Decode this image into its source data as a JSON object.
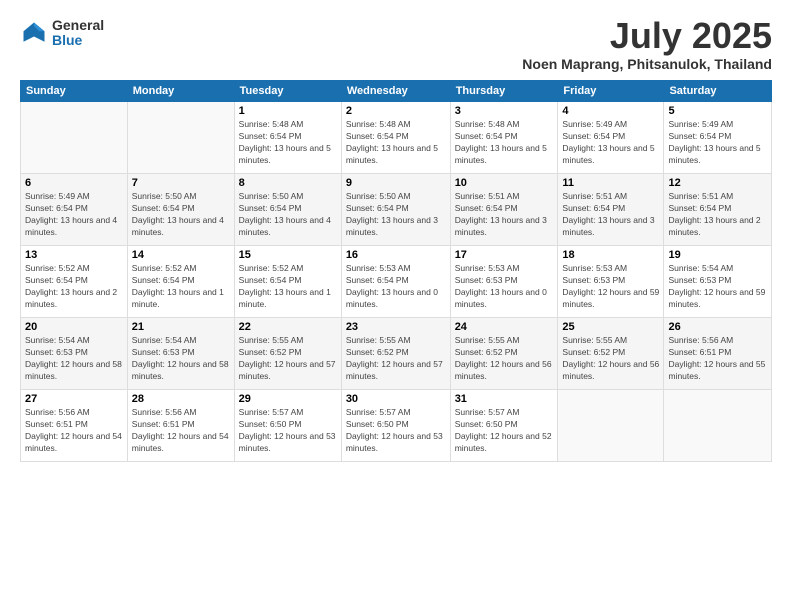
{
  "header": {
    "logo_general": "General",
    "logo_blue": "Blue",
    "month_year": "July 2025",
    "location": "Noen Maprang, Phitsanulok, Thailand"
  },
  "weekdays": [
    "Sunday",
    "Monday",
    "Tuesday",
    "Wednesday",
    "Thursday",
    "Friday",
    "Saturday"
  ],
  "weeks": [
    [
      {
        "day": "",
        "info": ""
      },
      {
        "day": "",
        "info": ""
      },
      {
        "day": "1",
        "info": "Sunrise: 5:48 AM\nSunset: 6:54 PM\nDaylight: 13 hours and 5 minutes."
      },
      {
        "day": "2",
        "info": "Sunrise: 5:48 AM\nSunset: 6:54 PM\nDaylight: 13 hours and 5 minutes."
      },
      {
        "day": "3",
        "info": "Sunrise: 5:48 AM\nSunset: 6:54 PM\nDaylight: 13 hours and 5 minutes."
      },
      {
        "day": "4",
        "info": "Sunrise: 5:49 AM\nSunset: 6:54 PM\nDaylight: 13 hours and 5 minutes."
      },
      {
        "day": "5",
        "info": "Sunrise: 5:49 AM\nSunset: 6:54 PM\nDaylight: 13 hours and 5 minutes."
      }
    ],
    [
      {
        "day": "6",
        "info": "Sunrise: 5:49 AM\nSunset: 6:54 PM\nDaylight: 13 hours and 4 minutes."
      },
      {
        "day": "7",
        "info": "Sunrise: 5:50 AM\nSunset: 6:54 PM\nDaylight: 13 hours and 4 minutes."
      },
      {
        "day": "8",
        "info": "Sunrise: 5:50 AM\nSunset: 6:54 PM\nDaylight: 13 hours and 4 minutes."
      },
      {
        "day": "9",
        "info": "Sunrise: 5:50 AM\nSunset: 6:54 PM\nDaylight: 13 hours and 3 minutes."
      },
      {
        "day": "10",
        "info": "Sunrise: 5:51 AM\nSunset: 6:54 PM\nDaylight: 13 hours and 3 minutes."
      },
      {
        "day": "11",
        "info": "Sunrise: 5:51 AM\nSunset: 6:54 PM\nDaylight: 13 hours and 3 minutes."
      },
      {
        "day": "12",
        "info": "Sunrise: 5:51 AM\nSunset: 6:54 PM\nDaylight: 13 hours and 2 minutes."
      }
    ],
    [
      {
        "day": "13",
        "info": "Sunrise: 5:52 AM\nSunset: 6:54 PM\nDaylight: 13 hours and 2 minutes."
      },
      {
        "day": "14",
        "info": "Sunrise: 5:52 AM\nSunset: 6:54 PM\nDaylight: 13 hours and 1 minute."
      },
      {
        "day": "15",
        "info": "Sunrise: 5:52 AM\nSunset: 6:54 PM\nDaylight: 13 hours and 1 minute."
      },
      {
        "day": "16",
        "info": "Sunrise: 5:53 AM\nSunset: 6:54 PM\nDaylight: 13 hours and 0 minutes."
      },
      {
        "day": "17",
        "info": "Sunrise: 5:53 AM\nSunset: 6:53 PM\nDaylight: 13 hours and 0 minutes."
      },
      {
        "day": "18",
        "info": "Sunrise: 5:53 AM\nSunset: 6:53 PM\nDaylight: 12 hours and 59 minutes."
      },
      {
        "day": "19",
        "info": "Sunrise: 5:54 AM\nSunset: 6:53 PM\nDaylight: 12 hours and 59 minutes."
      }
    ],
    [
      {
        "day": "20",
        "info": "Sunrise: 5:54 AM\nSunset: 6:53 PM\nDaylight: 12 hours and 58 minutes."
      },
      {
        "day": "21",
        "info": "Sunrise: 5:54 AM\nSunset: 6:53 PM\nDaylight: 12 hours and 58 minutes."
      },
      {
        "day": "22",
        "info": "Sunrise: 5:55 AM\nSunset: 6:52 PM\nDaylight: 12 hours and 57 minutes."
      },
      {
        "day": "23",
        "info": "Sunrise: 5:55 AM\nSunset: 6:52 PM\nDaylight: 12 hours and 57 minutes."
      },
      {
        "day": "24",
        "info": "Sunrise: 5:55 AM\nSunset: 6:52 PM\nDaylight: 12 hours and 56 minutes."
      },
      {
        "day": "25",
        "info": "Sunrise: 5:55 AM\nSunset: 6:52 PM\nDaylight: 12 hours and 56 minutes."
      },
      {
        "day": "26",
        "info": "Sunrise: 5:56 AM\nSunset: 6:51 PM\nDaylight: 12 hours and 55 minutes."
      }
    ],
    [
      {
        "day": "27",
        "info": "Sunrise: 5:56 AM\nSunset: 6:51 PM\nDaylight: 12 hours and 54 minutes."
      },
      {
        "day": "28",
        "info": "Sunrise: 5:56 AM\nSunset: 6:51 PM\nDaylight: 12 hours and 54 minutes."
      },
      {
        "day": "29",
        "info": "Sunrise: 5:57 AM\nSunset: 6:50 PM\nDaylight: 12 hours and 53 minutes."
      },
      {
        "day": "30",
        "info": "Sunrise: 5:57 AM\nSunset: 6:50 PM\nDaylight: 12 hours and 53 minutes."
      },
      {
        "day": "31",
        "info": "Sunrise: 5:57 AM\nSunset: 6:50 PM\nDaylight: 12 hours and 52 minutes."
      },
      {
        "day": "",
        "info": ""
      },
      {
        "day": "",
        "info": ""
      }
    ]
  ]
}
